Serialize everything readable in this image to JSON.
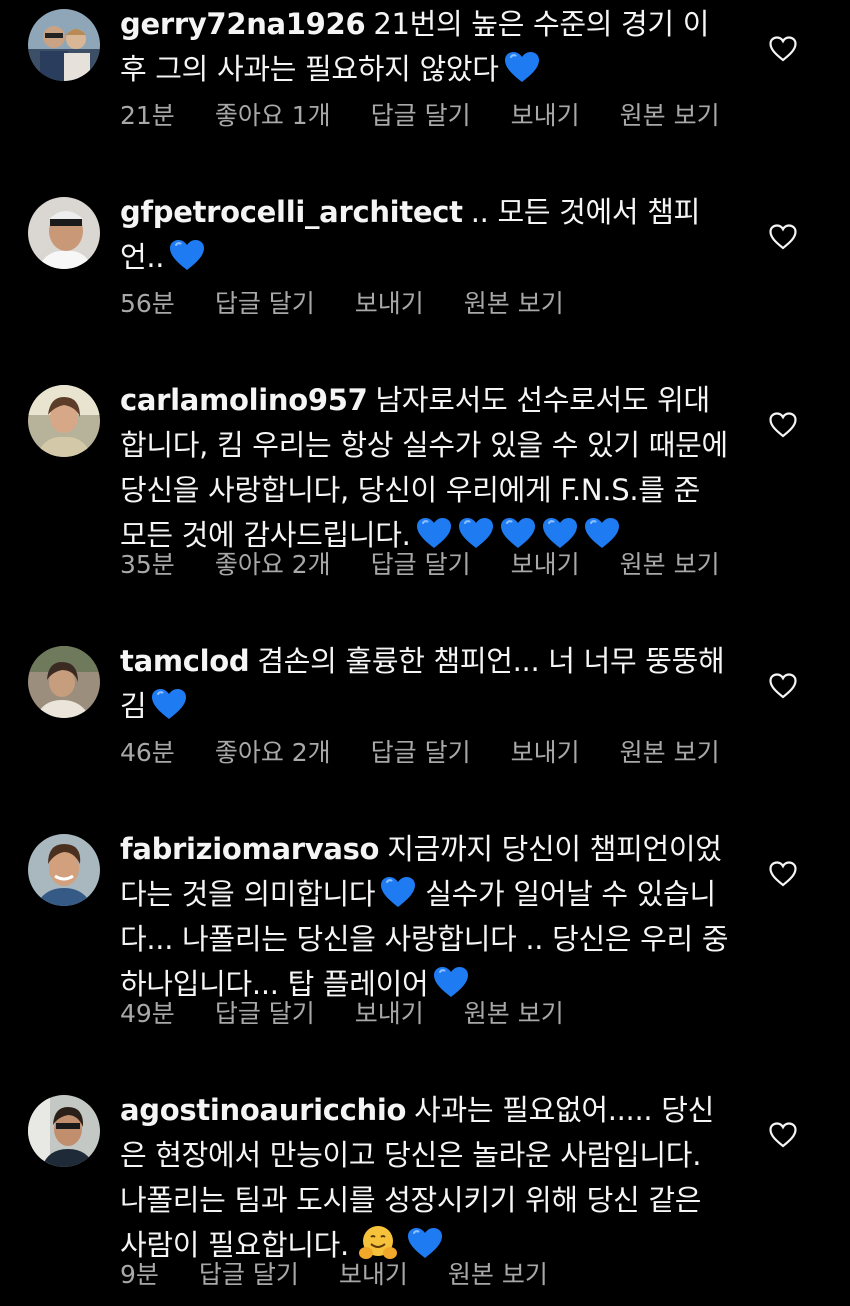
{
  "comments": [
    {
      "user": "gerry72na1926",
      "text": "21번의 높은 수준의 경기 이후 그의 사과는 필요하지 않았다",
      "emoji": [
        "blue-heart"
      ],
      "time": "21분",
      "likes": "좋아요 1개",
      "reply": "답글 달기",
      "send": "보내기",
      "original": "원본 보기"
    },
    {
      "user": "gfpetrocelli_architect",
      "text": ".. 모든 것에서 챔피언..",
      "emoji": [
        "blue-heart"
      ],
      "time": "56분",
      "likes": "",
      "reply": "답글 달기",
      "send": "보내기",
      "original": "원본 보기"
    },
    {
      "user": "carlamolino957",
      "text": "남자로서도 선수로서도 위대합니다, 킴 우리는 항상 실수가 있을 수 있기 때문에 당신을 사랑합니다, 당신이 우리에게 F.N.S.를 준 모든 것에 감사드립니다.",
      "emoji": [
        "blue-heart",
        "blue-heart",
        "blue-heart",
        "blue-heart",
        "blue-heart"
      ],
      "time": "35분",
      "likes": "좋아요 2개",
      "reply": "답글 달기",
      "send": "보내기",
      "original": "원본 보기"
    },
    {
      "user": "tamclod",
      "text": "겸손의 훌륭한 챔피언... 너 너무 뚱뚱해 김",
      "emoji": [
        "blue-heart"
      ],
      "time": "46분",
      "likes": "좋아요 2개",
      "reply": "답글 달기",
      "send": "보내기",
      "original": "원본 보기"
    },
    {
      "user": "fabriziomarvaso",
      "text_a": "지금까지 당신이 챔피언이었다는 것을 의미합니다",
      "text_b": "실수가 일어날 수 있습니다... 나폴리는 당신을 사랑합니다 .. 당신은 우리 중 하나입니다... 탑 플레이어",
      "emoji": [
        "blue-heart",
        "blue-heart"
      ],
      "time": "49분",
      "likes": "",
      "reply": "답글 달기",
      "send": "보내기",
      "original": "원본 보기"
    },
    {
      "user": "agostinoauricchio",
      "text": "사과는 필요없어..... 당신은 현장에서 만능이고 당신은 놀라운 사람입니다. 나폴리는 팀과 도시를 성장시키기 위해 당신 같은 사람이 필요합니다.",
      "emoji": [
        "hugging-face",
        "blue-heart"
      ],
      "time": "9분",
      "likes": "",
      "reply": "답글 달기",
      "send": "보내기",
      "original": "원본 보기"
    }
  ],
  "colors": {
    "background": "#000000",
    "text": "#f5f5f5",
    "meta": "#a8a8a8",
    "blue_heart": "#1f7bf2"
  }
}
